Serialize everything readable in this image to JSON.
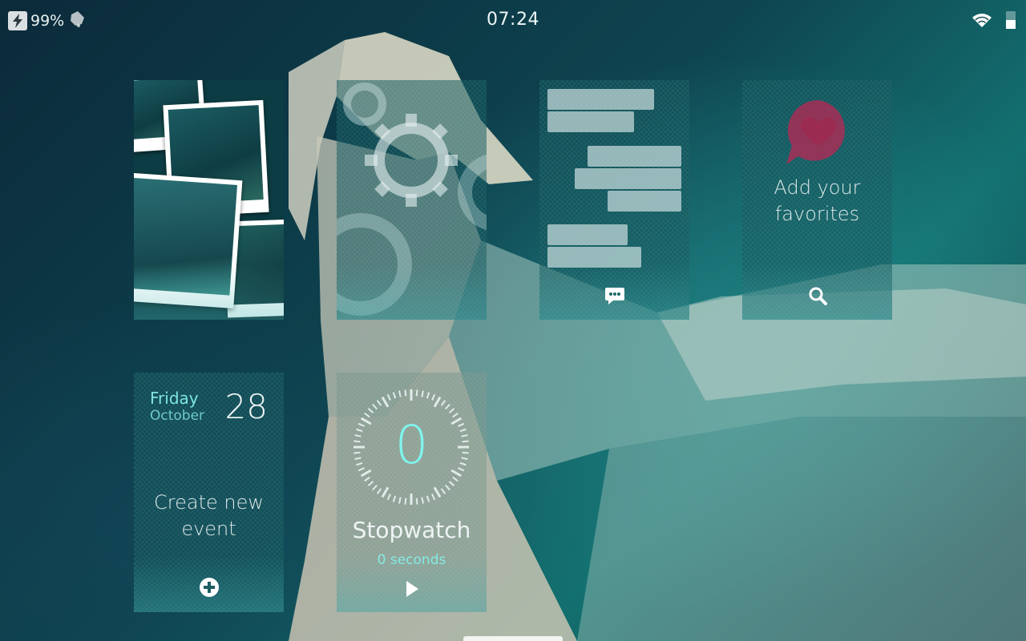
{
  "status_bar": {
    "battery_percent": "99%",
    "clock": "07:24",
    "icons": [
      "charging-bolt-icon",
      "notification-bell-icon",
      "wifi-icon",
      "sim-card-icon"
    ]
  },
  "tiles": {
    "gallery": {
      "icon": "photos-stack"
    },
    "settings": {
      "icon": "gear-icon"
    },
    "messages": {
      "icon": "chat-bubble-icon"
    },
    "favorites": {
      "line1": "Add your",
      "line2": "favorites",
      "icon": "search-icon",
      "accent": "#b02a55"
    },
    "calendar": {
      "weekday": "Friday",
      "month": "October",
      "day": "28",
      "create_line1": "Create new",
      "create_line2": "event",
      "icon": "plus-circle-icon"
    },
    "stopwatch": {
      "value": "0",
      "title": "Stopwatch",
      "subtitle": "0 seconds",
      "icon": "play-icon"
    }
  },
  "colors": {
    "accent_cyan": "#7ff4ee",
    "tile_bg": "#145a5f"
  }
}
